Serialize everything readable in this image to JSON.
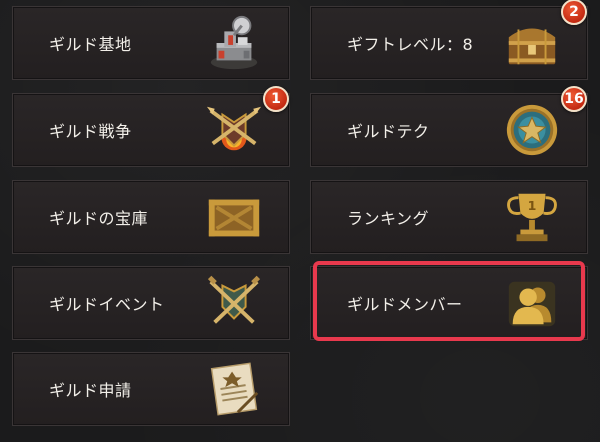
{
  "menu": {
    "guild_base": {
      "label": "ギルド基地",
      "icon": "guild-base-building-icon"
    },
    "gift_level": {
      "label": "ギフトレベル：8",
      "icon": "treasure-chest-icon",
      "badge": "2"
    },
    "guild_war": {
      "label": "ギルド戦争",
      "icon": "crossed-missiles-emblem-icon",
      "badge": "1"
    },
    "guild_tech": {
      "label": "ギルドテク",
      "icon": "star-medal-icon",
      "badge": "16"
    },
    "guild_treasury": {
      "label": "ギルドの宝庫",
      "icon": "wooden-crate-icon"
    },
    "ranking": {
      "label": "ランキング",
      "icon": "trophy-icon"
    },
    "guild_event": {
      "label": "ギルドイベント",
      "icon": "crossed-swords-shield-icon"
    },
    "guild_members": {
      "label": "ギルドメンバー",
      "icon": "members-silhouette-icon",
      "highlighted": true
    },
    "guild_application": {
      "label": "ギルド申請",
      "icon": "scroll-letter-icon"
    }
  },
  "colors": {
    "highlight": "#e8394d",
    "badge": "#d9361a",
    "gold": "#c99a3b"
  }
}
